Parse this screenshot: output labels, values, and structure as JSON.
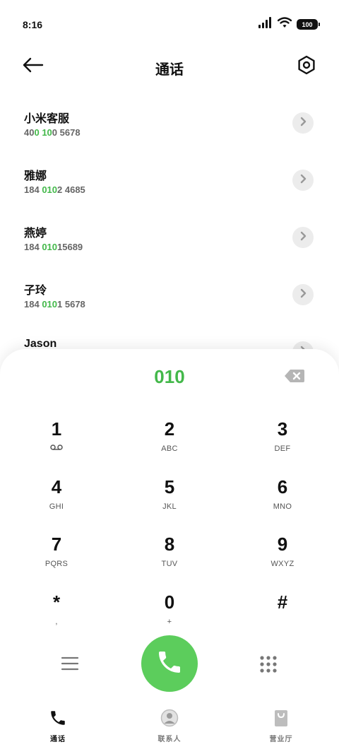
{
  "status_bar": {
    "time": "8:16",
    "battery": "100",
    "icons": [
      "signal-icon",
      "wifi-icon",
      "battery-icon"
    ]
  },
  "header": {
    "title": "通话",
    "back_icon": "arrow-left-icon",
    "settings_icon": "hexagon-settings-icon"
  },
  "contacts": [
    {
      "name": "小米客服",
      "number_parts": [
        "40",
        "0",
        " ",
        "10",
        "0 5678"
      ],
      "highlight": [
        false,
        true,
        false,
        true,
        false
      ]
    },
    {
      "name": "雅娜",
      "number_parts": [
        "184 ",
        "010",
        "2 4685"
      ],
      "highlight": [
        false,
        true,
        false
      ]
    },
    {
      "name": "燕婷",
      "number_parts": [
        "184 ",
        "010",
        "15689"
      ],
      "highlight": [
        false,
        true,
        false
      ]
    },
    {
      "name": "子玲",
      "number_parts": [
        "184 ",
        "010",
        "1 5678"
      ],
      "highlight": [
        false,
        true,
        false
      ]
    },
    {
      "name": "Jason",
      "number_parts": [],
      "highlight": []
    }
  ],
  "dialer": {
    "input": "010",
    "keys": [
      [
        {
          "digit": "1",
          "sub": ""
        },
        {
          "digit": "2",
          "sub": "ABC"
        },
        {
          "digit": "3",
          "sub": "DEF"
        }
      ],
      [
        {
          "digit": "4",
          "sub": "GHI"
        },
        {
          "digit": "5",
          "sub": "JKL"
        },
        {
          "digit": "6",
          "sub": "MNO"
        }
      ],
      [
        {
          "digit": "7",
          "sub": "PQRS"
        },
        {
          "digit": "8",
          "sub": "TUV"
        },
        {
          "digit": "9",
          "sub": "WXYZ"
        }
      ],
      [
        {
          "digit": "*",
          "sub": ","
        },
        {
          "digit": "0",
          "sub": "+"
        },
        {
          "digit": "#",
          "sub": ""
        }
      ]
    ]
  },
  "bottom_nav": [
    {
      "label": "通话",
      "icon": "phone-icon",
      "active": true
    },
    {
      "label": "联系人",
      "icon": "contact-icon",
      "active": false
    },
    {
      "label": "营业厅",
      "icon": "shopping-bag-icon",
      "active": false
    }
  ],
  "colors": {
    "accent": "#43b84a",
    "call_button": "#5ccd5c"
  }
}
